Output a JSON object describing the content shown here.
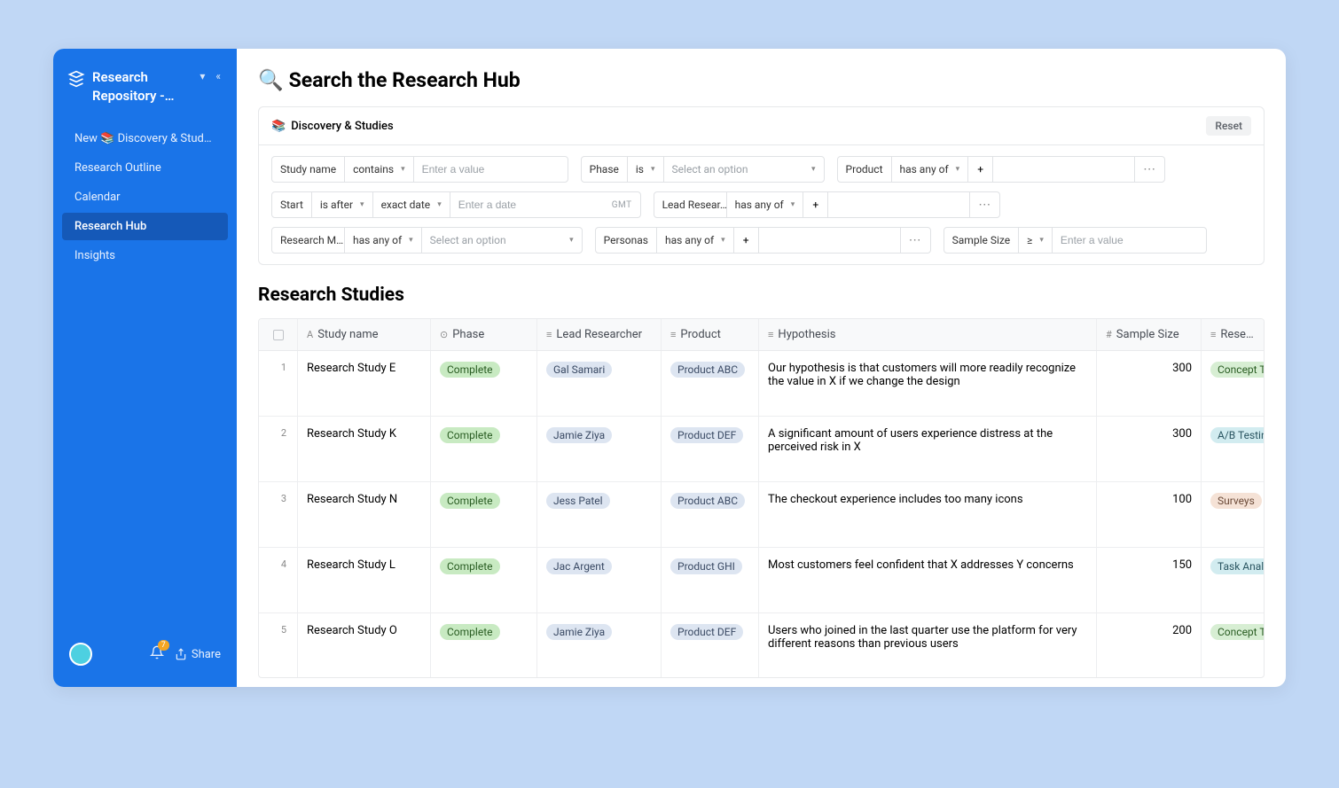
{
  "workspace": {
    "title": "Research Repository -…"
  },
  "nav": {
    "items": [
      {
        "label": "New 📚 Discovery & Study E…"
      },
      {
        "label": "Research Outline"
      },
      {
        "label": "Calendar"
      },
      {
        "label": "Research Hub"
      },
      {
        "label": "Insights"
      }
    ],
    "activeIndex": 3
  },
  "sidebarFooter": {
    "badge": "7",
    "share": "Share"
  },
  "page": {
    "titleIcon": "🔍",
    "title": "Search the Research Hub",
    "sectionTitle": "Research Studies"
  },
  "filterPanel": {
    "headerLabel": "Discovery & Studies",
    "headerIcon": "📚",
    "reset": "Reset"
  },
  "filters": {
    "row1": {
      "studyName": {
        "label": "Study name",
        "op": "contains",
        "placeholder": "Enter a value"
      },
      "phase": {
        "label": "Phase",
        "op": "is",
        "placeholder": "Select an option"
      },
      "product": {
        "label": "Product",
        "op": "has any of"
      }
    },
    "row2": {
      "start": {
        "label": "Start",
        "op": "is after",
        "op2": "exact date",
        "placeholder": "Enter a date",
        "tz": "GMT"
      },
      "leadResearcher": {
        "label": "Lead Resear…",
        "op": "has any of"
      }
    },
    "row3": {
      "researchM": {
        "label": "Research M…",
        "op": "has any of",
        "placeholder": "Select an option"
      },
      "personas": {
        "label": "Personas",
        "op": "has any of"
      },
      "sampleSize": {
        "label": "Sample Size",
        "op": "≥",
        "placeholder": "Enter a value"
      }
    }
  },
  "table": {
    "columns": {
      "study": "Study name",
      "phase": "Phase",
      "lead": "Lead Researcher",
      "product": "Product",
      "hypothesis": "Hypothesis",
      "sample": "Sample Size",
      "method": "Researc"
    },
    "rows": [
      {
        "num": "1",
        "study": "Research Study E",
        "phase": "Complete",
        "phaseColor": "green",
        "lead": "Gal Samari",
        "product": "Product ABC",
        "hypothesis": "Our hypothesis is that customers will more readily recognize the value in X if we change the design",
        "sample": "300",
        "method": "Concept T",
        "methodColor": "lightgreen"
      },
      {
        "num": "2",
        "study": "Research Study K",
        "phase": "Complete",
        "phaseColor": "green",
        "lead": "Jamie Ziya",
        "product": "Product DEF",
        "hypothesis": "A significant amount of users experience distress at the perceived risk in X",
        "sample": "300",
        "method": "A/B Testin",
        "methodColor": "teal"
      },
      {
        "num": "3",
        "study": "Research Study N",
        "phase": "Complete",
        "phaseColor": "green",
        "lead": "Jess Patel",
        "product": "Product ABC",
        "hypothesis": "The checkout experience includes too many icons",
        "sample": "100",
        "method": "Surveys",
        "methodColor": "peach"
      },
      {
        "num": "4",
        "study": "Research Study L",
        "phase": "Complete",
        "phaseColor": "green",
        "lead": "Jac Argent",
        "product": "Product GHI",
        "hypothesis": "Most customers feel confident that X addresses Y concerns",
        "sample": "150",
        "method": "Task Analy",
        "methodColor": "teal"
      },
      {
        "num": "5",
        "study": "Research Study O",
        "phase": "Complete",
        "phaseColor": "green",
        "lead": "Jamie Ziya",
        "product": "Product DEF",
        "hypothesis": "Users who joined in the last quarter use the platform for very different reasons than previous users",
        "sample": "200",
        "method": "Concept T",
        "methodColor": "lightgreen"
      }
    ]
  }
}
